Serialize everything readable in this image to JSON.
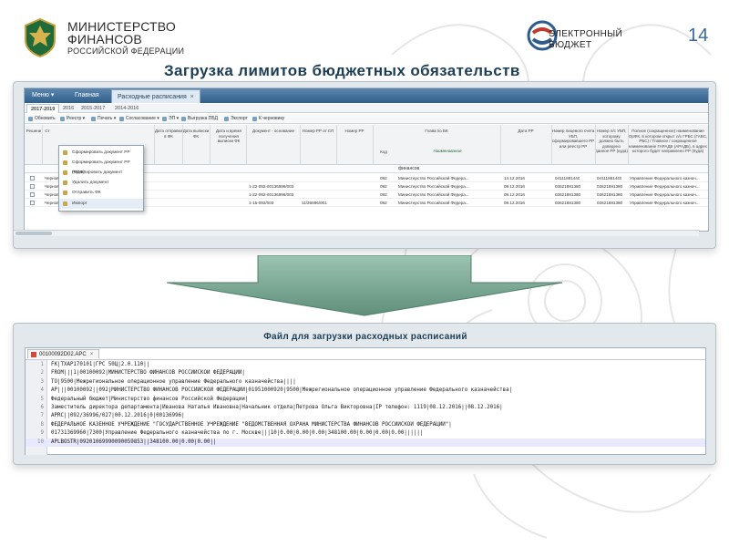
{
  "header": {
    "ministry_line1": "МИНИСТЕРСТВО",
    "ministry_line2": "ФИНАНСОВ",
    "ministry_line3": "РОССИЙСКОЙ ФЕДЕРАЦИИ",
    "eb_line1": "ЭЛЕКТРОННЫЙ",
    "eb_line2": "БЮДЖЕТ",
    "page_number": "14",
    "title": "Загрузка лимитов бюджетных обязательств"
  },
  "app": {
    "nav": {
      "menu": "Меню ▾",
      "home": "Главная",
      "active_tab": "Расходные расписания",
      "close": "×"
    },
    "year_tabs": [
      "2017-2019",
      "2016",
      "2015-2017",
      "2014-2016"
    ],
    "toolbar": [
      "Обновить",
      "Реестр ▾",
      "Печать ▾",
      "Согласование ▾",
      "ЭП ▾",
      "Выгрузка ПБД",
      "Экспорт",
      "К черновику"
    ],
    "grid_headers": {
      "col1": "Решени",
      "col2": "Ст",
      "col_fk_sent": "Дата отправки в ФК",
      "col_fk_out": "Дата выписки ФК",
      "col_fk_recv": "Дата и время получения выписки ФК",
      "col_doc": "Документ - основание",
      "col_num_sp": "Номер РР от СП",
      "col_num_rr": "Номер РР",
      "col_head_fk": "Глава по БК",
      "col_code": "Код",
      "col_name": "Наименование",
      "col_date_rr": "Дата РР",
      "col_acct": "Номер лицевого счета УБП, сформировавшего РР или реестр РР",
      "col_acct2": "Номер л/с УБП, которому должно быть доведено данное РР (куда)",
      "col_full": "Полное (сокращенное) наименование ОрФК, в котором открыт л/с ГРБС (ГАБС, РБС) / Главное / сокращенное наименование ГАРАДБ (АРАДБ), в адрес которого будет направлено РР (Куда)"
    },
    "filter_value": "финансов",
    "dropdown": [
      "Сформировать документ РР",
      "Сформировать документ РР (ПОФ)",
      "Редактировать документ",
      "Удалить документ",
      "Отправить ФК",
      "Импорт"
    ],
    "rows": [
      {
        "status": "Черновик",
        "type": "",
        "doc": "",
        "num_sp": "",
        "code": "092",
        "head": "Министерство Российской Федера...",
        "date": "14.12.2016",
        "acct": "04111881440",
        "acct2": "04111881440",
        "org": "Управление Федерального казнач..."
      },
      {
        "status": "Черновик",
        "type": "Расходное",
        "doc": "1-22-092-00136996/003",
        "num_sp": "",
        "code": "092",
        "head": "Министерство Российской Федера...",
        "date": "09.12.2016",
        "acct": "03621881380",
        "acct2": "03621881380",
        "org": "Управление Федерального казнач..."
      },
      {
        "status": "Черновик",
        "type": "Расходное",
        "doc": "1-22-092-00136996/003",
        "num_sp": "",
        "code": "092",
        "head": "Министерство Российской Федера...",
        "date": "09.12.2016",
        "acct": "03621881380",
        "acct2": "03621881380",
        "org": "Управление Федерального казнач..."
      },
      {
        "status": "Черновик",
        "type": "Расходное",
        "doc": "1-15-092/003",
        "num_sp": "11/36996/001",
        "code": "092",
        "head": "Министерство Российской Федера...",
        "date": "09.12.2016",
        "acct": "03621881380",
        "acct2": "03621881380",
        "org": "Управление Федерального казнач..."
      }
    ]
  },
  "file_panel": {
    "title": "Файл для загрузки расходных расписаний",
    "tab_name": "00100092D02.APC",
    "tab_close": "×",
    "lines": [
      "FK|TXAP170101|ГРС 50Ц|2.0.110||",
      "FROM|||1|00100092|МИНИСТЕРСТВО ФИНАНСОВ РОССИЙСКОЙ ФЕДЕРАЦИИ|",
      "TO|9500|Межрегиональное операционное управление Федерального казначейства||||",
      "AP|||00100092||092|МИНИСТЕРСТВО ФИНАНСОВ РОССИЙСКОЙ ФЕДЕРАЦИИ|01951000920|9500|Межрегиональное операционное управление Федерального казначейства|",
      "Федеральный бюджет|Министерство финансов Российской Федерации|",
      "Заместитель директора департамента|Иванова Наталья Ивановна|Начальник отдела|Петрова Ольга  Викторовна|IP телефон: 1119|08.12.2016||08.12.2016|",
      "APRC||092/36996/027|00.12.2016|0|00136996|",
      "ФЕДЕРАЛЬНОЕ КАЗЕННОЕ УЧРЕЖДЕНИЕ \"ГОСУДАРСТВЕННОЕ УЧРЕЖДЕНИЕ \"ВЕДОМСТВЕННАЯ ОХРАНА МИНИСТЕРСТВА ФИНАНСОВ РОССИЙСКОЙ ФЕДЕРАЦИИ\"|",
      "01731369960|7300|Управление Федерального казначейства по г. Москве|||10|0.00|0.00|0.00|348100.00|0.00|0.00|0.00||||||",
      "APLBOSTR|09201069990090059853||348100.00|0.00|0.00||"
    ]
  },
  "colors": {
    "title": "#1d3d55",
    "nav": "#2f5f8c",
    "arrow": "#7aa591"
  }
}
